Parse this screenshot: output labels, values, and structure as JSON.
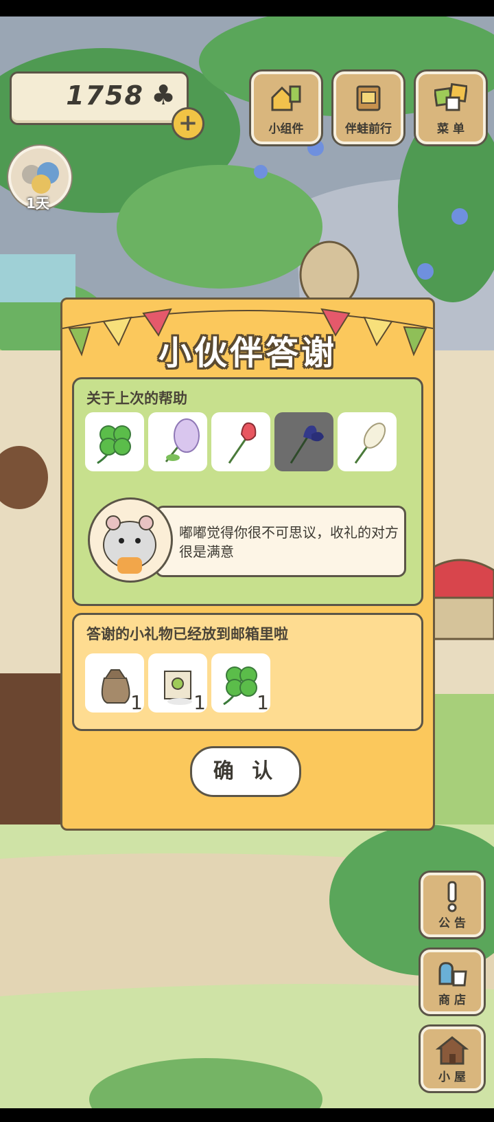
{
  "currency": {
    "clovers": "1758",
    "clover_icon": "♣",
    "add_label": "+"
  },
  "frog": {
    "days": "1天"
  },
  "top_buttons": [
    {
      "label": "小组件",
      "icon": "widget-icon"
    },
    {
      "label": "伴蛙前行",
      "icon": "journey-icon"
    },
    {
      "label": "菜 单",
      "icon": "menu-icon"
    }
  ],
  "side_buttons": [
    {
      "label": "公 告",
      "icon": "exclamation-icon"
    },
    {
      "label": "商 店",
      "icon": "shop-bags-icon"
    },
    {
      "label": "小 屋",
      "icon": "house-icon"
    }
  ],
  "dialog": {
    "title": "小伙伴答谢",
    "help_title": "关于上次的帮助",
    "help_items": [
      "four-leaf-clover",
      "lilac",
      "tulip",
      "iris",
      "hyacinth"
    ],
    "selected_index": 3,
    "message": "嘟嘟觉得你很不可思议，收礼的对方很是满意",
    "gift_title": "答谢的小礼物已经放到邮箱里啦",
    "gifts": [
      {
        "icon": "seed-bag-icon",
        "count": "1"
      },
      {
        "icon": "seed-packet-icon",
        "count": "1"
      },
      {
        "icon": "four-leaf-clover-icon",
        "count": "1"
      }
    ],
    "confirm_label": "确 认"
  },
  "colors": {
    "dialog_bg": "#fbc85c",
    "help_bg": "#c7e08d",
    "gift_bg": "#fedc91",
    "tile_bg": "#d9b67d"
  }
}
